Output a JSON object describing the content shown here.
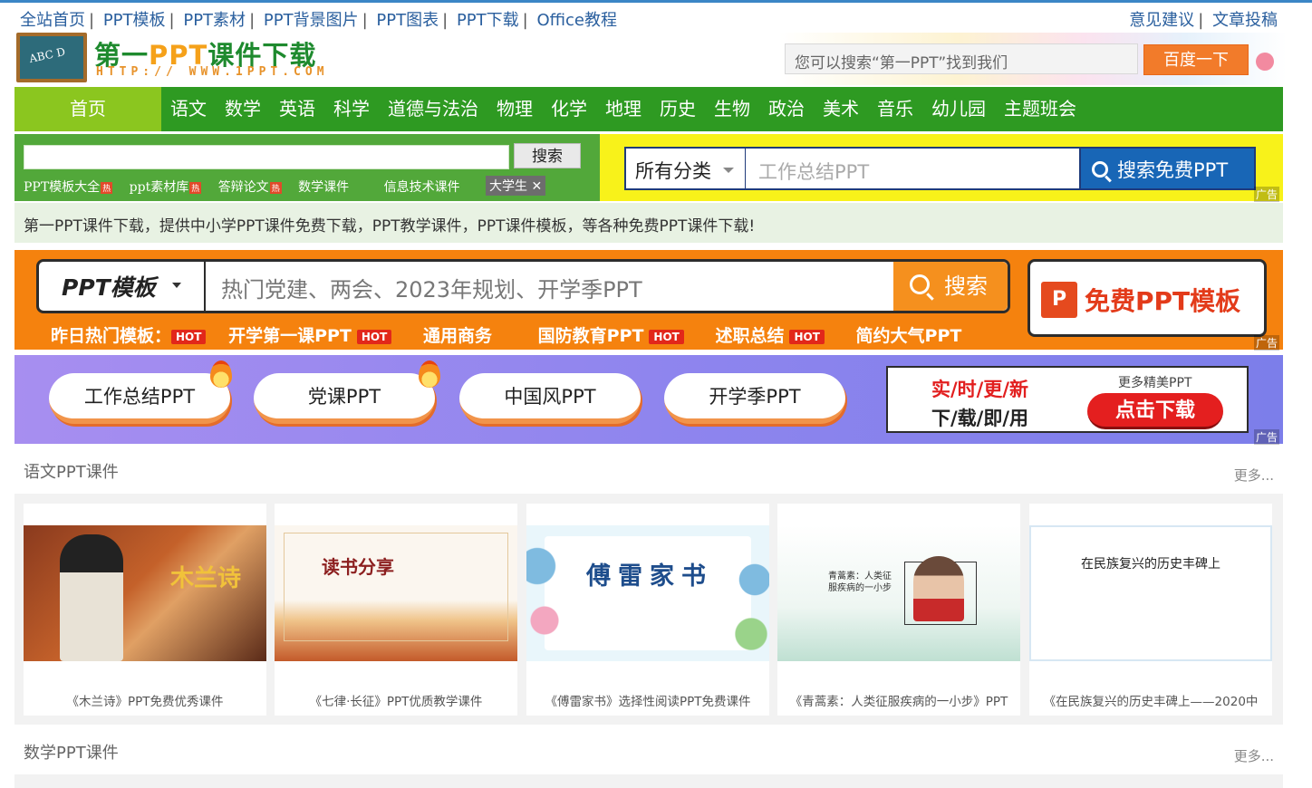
{
  "topbar": {
    "links": [
      "全站首页",
      "PPT模板",
      "PPT素材",
      "PPT背景图片",
      "PPT图表",
      "PPT下载",
      "Office教程"
    ],
    "right": [
      "意见建议",
      "文章投稿"
    ]
  },
  "logo": {
    "title_a": "第一",
    "title_b": "PPT",
    "title_c": "课件下载",
    "url": "HTTP:// WWW.1PPT.COM",
    "chalk": "ABC D"
  },
  "header_search": {
    "placeholder": "您可以搜索“第一PPT”找到我们",
    "button": "百度一下"
  },
  "nav": {
    "home": "首页",
    "items": [
      "语文",
      "数学",
      "英语",
      "科学",
      "道德与法治",
      "物理",
      "化学",
      "地理",
      "历史",
      "生物",
      "政治",
      "美术",
      "音乐",
      "幼儿园",
      "主题班会"
    ]
  },
  "sub_search": {
    "button": "搜索",
    "tags": [
      "PPT模板大全",
      "ppt素材库",
      "答辩论文",
      "数学课件",
      "信息技术课件"
    ],
    "hot_badge": "热",
    "more": "大学生"
  },
  "yellow_search": {
    "category": "所有分类",
    "placeholder": "工作总结PPT",
    "button": "搜索免费PPT",
    "ad": "广告"
  },
  "description": "第一PPT课件下载，提供中小学PPT课件免费下载，PPT教学课件，PPT课件模板，等各种免费PPT课件下载!",
  "orange_banner": {
    "select": "PPT模板",
    "placeholder": "热门党建、两会、2023年规划、开学季PPT",
    "button": "搜索",
    "free": "免费PPT模板",
    "free_icon": "P",
    "hot_label": "昨日热门模板：",
    "hot_items": [
      {
        "label": "开学第一课PPT",
        "hot": "HOT"
      },
      {
        "label": "通用商务",
        "hot": ""
      },
      {
        "label": "国防教育PPT",
        "hot": "HOT"
      },
      {
        "label": "述职总结",
        "hot": "HOT"
      },
      {
        "label": "简约大气PPT",
        "hot": ""
      }
    ],
    "first_hot": "HOT",
    "ad": "广告"
  },
  "purple_banner": {
    "pills": [
      "工作总结PPT",
      "党课PPT",
      "中国风PPT",
      "开学季PPT"
    ],
    "ad_line1": "实/时/更/新",
    "ad_line2": "下/载/即/用",
    "ad_more": "更多精美PPT",
    "ad_button": "点击下载",
    "ad": "广告"
  },
  "section1": {
    "title": "语文PPT课件",
    "more": "更多...",
    "cards": [
      {
        "caption": "《木兰诗》PPT免费优秀课件",
        "img_text": "木兰诗"
      },
      {
        "caption": "《七律·长征》PPT优质教学课件",
        "img_text": "读书分享"
      },
      {
        "caption": "《傅雷家书》选择性阅读PPT免费课件",
        "img_text": "傅雷家书"
      },
      {
        "caption": "《青蒿素：人类征服疾病的一小步》PPT",
        "img_text": "青蒿素：人类征服疾病的一小步"
      },
      {
        "caption": "《在民族复兴的历史丰碑上——2020中",
        "img_text": "在民族复兴的历史丰碑上"
      }
    ]
  },
  "section2": {
    "title": "数学PPT课件",
    "more": "更多..."
  },
  "colors": {
    "nav_green": "#2e9a22",
    "home_green": "#8bc61f",
    "orange": "#f5820e",
    "yellow": "#f8f21a",
    "blue_btn": "#1866b6"
  }
}
